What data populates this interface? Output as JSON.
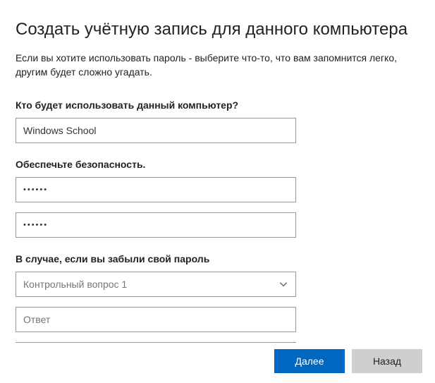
{
  "title": "Создать учётную запись для данного компьютера",
  "subtitle": "Если вы хотите использовать пароль - выберите что-то, что вам запомнится легко, другим будет сложно угадать.",
  "section": {
    "who_label": "Кто будет использовать данный компьютер?",
    "security_label": "Обеспечьте безопасность.",
    "forgot_label": "В случае, если вы забыли свой пароль"
  },
  "fields": {
    "username": {
      "value": "Windows School"
    },
    "password": {
      "masked": "••••••"
    },
    "password_confirm": {
      "masked": "••••••"
    },
    "security_question": {
      "selected": "Контрольный вопрос 1"
    },
    "security_answer": {
      "placeholder": "Ответ"
    }
  },
  "buttons": {
    "next": "Далее",
    "back": "Назад"
  },
  "colors": {
    "primary": "#0067c0",
    "secondary_bg": "#cfcfcf"
  }
}
